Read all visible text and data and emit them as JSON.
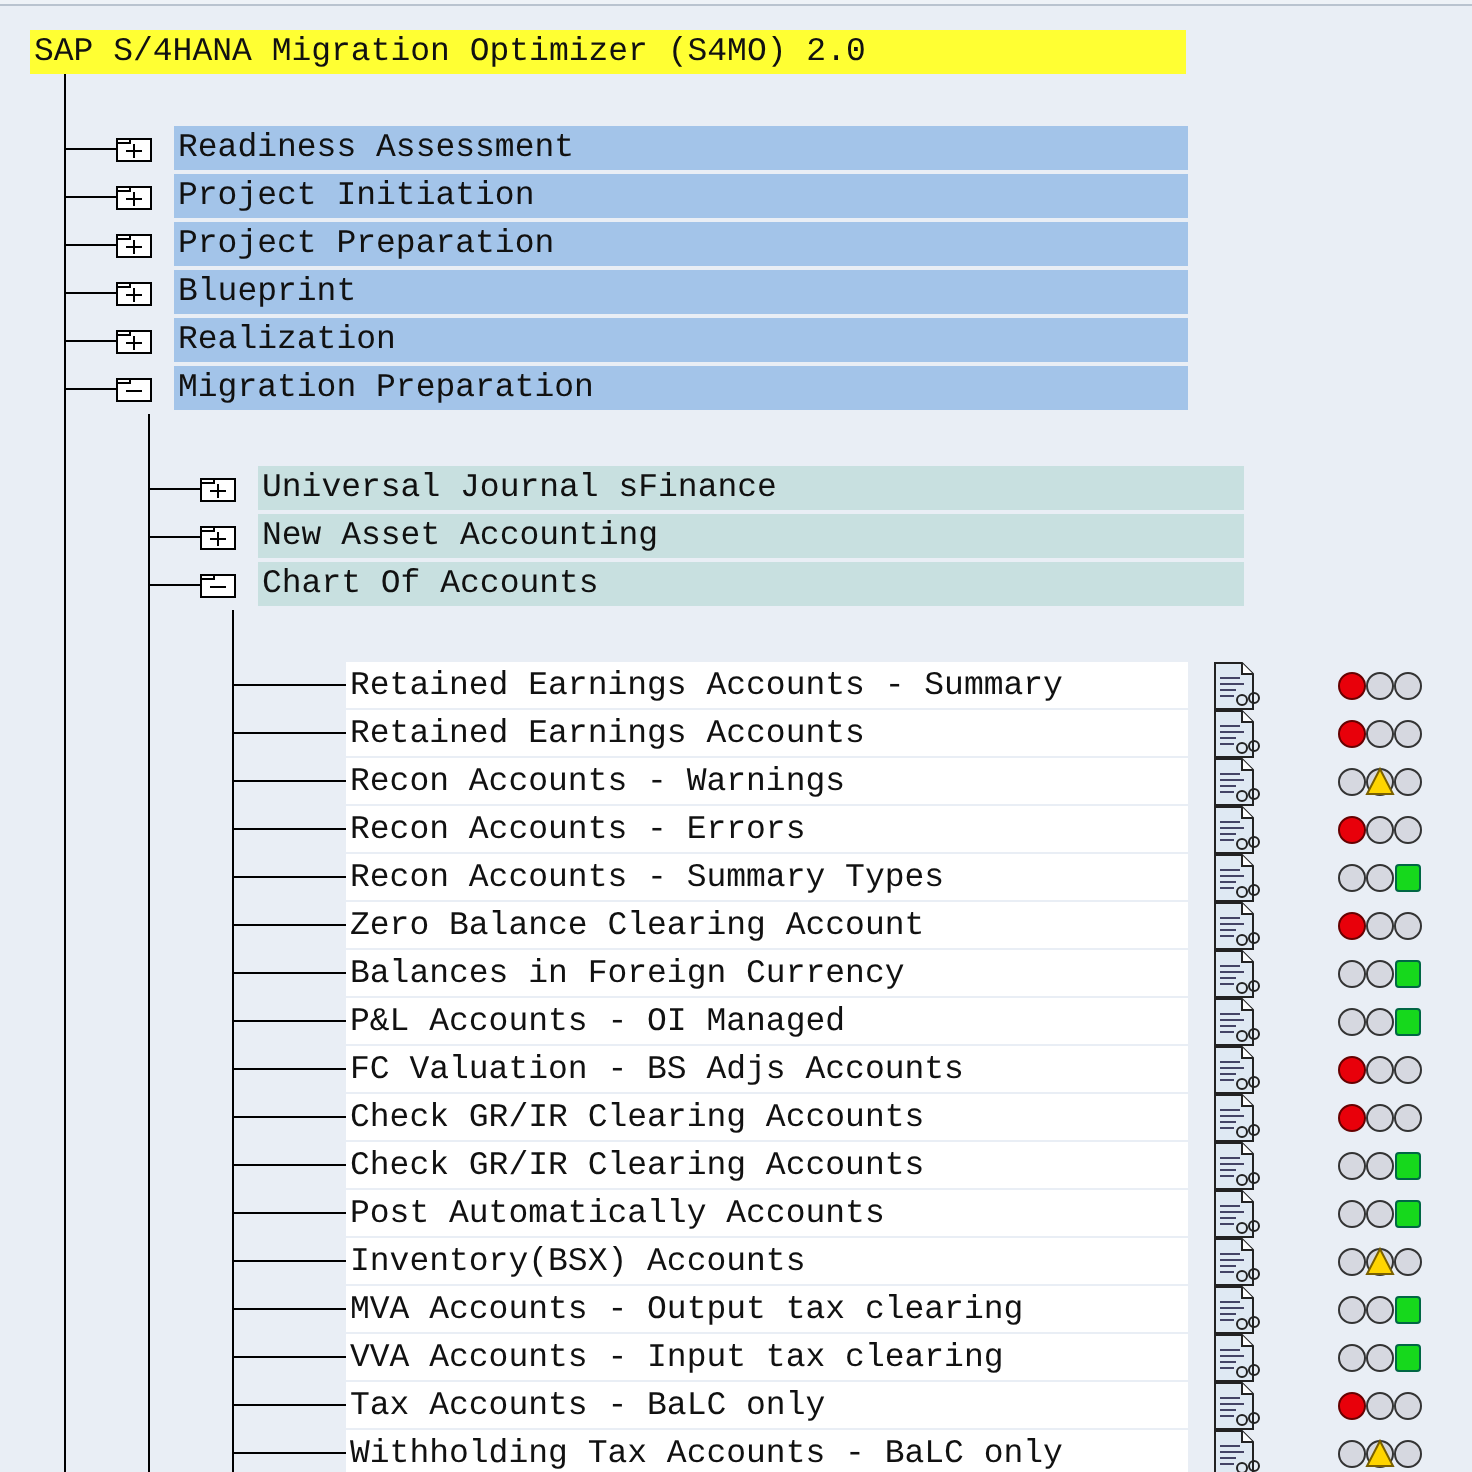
{
  "title": "SAP S/4HANA Migration Optimizer (S4MO) 2.0",
  "tree": [
    {
      "label": "Readiness Assessment",
      "expanded": false
    },
    {
      "label": "Project Initiation",
      "expanded": false
    },
    {
      "label": "Project Preparation",
      "expanded": false
    },
    {
      "label": "Blueprint",
      "expanded": false
    },
    {
      "label": "Realization",
      "expanded": false
    },
    {
      "label": "Migration Preparation",
      "expanded": true,
      "children": [
        {
          "label": "Universal Journal sFinance",
          "expanded": false
        },
        {
          "label": "New Asset Accounting",
          "expanded": false
        },
        {
          "label": "Chart Of Accounts",
          "expanded": true,
          "children": [
            {
              "label": "Retained Earnings Accounts - Summary",
              "kind": "red"
            },
            {
              "label": "Retained Earnings Accounts",
              "kind": "red"
            },
            {
              "label": "Recon Accounts - Warnings",
              "kind": "yellow"
            },
            {
              "label": "Recon Accounts - Errors",
              "kind": "red"
            },
            {
              "label": "Recon Accounts - Summary Types",
              "kind": "green"
            },
            {
              "label": "Zero Balance Clearing Account",
              "kind": "red"
            },
            {
              "label": "Balances in Foreign Currency",
              "kind": "green"
            },
            {
              "label": "P&L Accounts - OI Managed",
              "kind": "green"
            },
            {
              "label": "FC Valuation - BS Adjs Accounts",
              "kind": "red"
            },
            {
              "label": "Check GR/IR Clearing Accounts",
              "kind": "red"
            },
            {
              "label": "Check GR/IR Clearing Accounts",
              "kind": "green"
            },
            {
              "label": "Post Automatically Accounts",
              "kind": "green"
            },
            {
              "label": "Inventory(BSX) Accounts",
              "kind": "yellow"
            },
            {
              "label": "MVA Accounts - Output tax clearing",
              "kind": "green"
            },
            {
              "label": "VVA Accounts - Input tax clearing",
              "kind": "green"
            },
            {
              "label": "Tax Accounts - BaLC only",
              "kind": "red"
            },
            {
              "label": "Withholding Tax Accounts - BaLC only",
              "kind": "yellow"
            }
          ]
        }
      ]
    }
  ]
}
